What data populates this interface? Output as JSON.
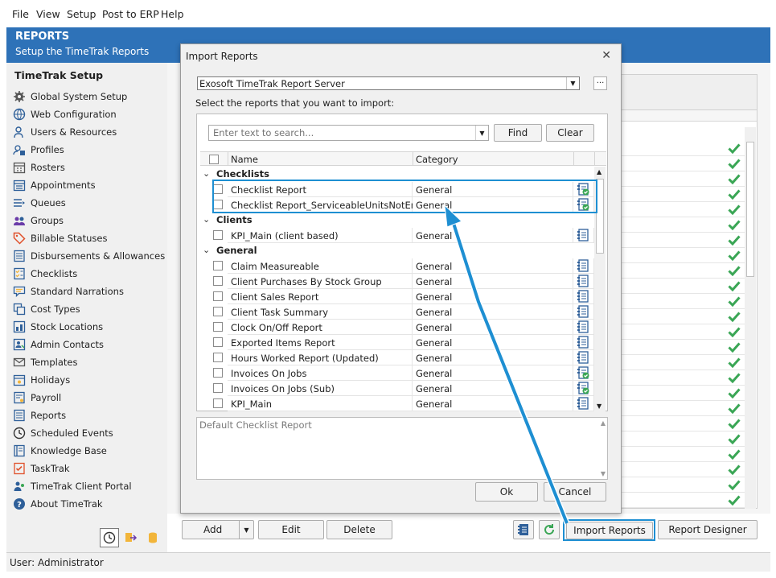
{
  "menu": [
    "File",
    "View",
    "Setup",
    "Post to ERP",
    "Help"
  ],
  "header": {
    "title": "REPORTS",
    "subtitle": "Setup the TimeTrak Reports"
  },
  "nav": {
    "title": "TimeTrak Setup",
    "items": [
      {
        "label": "Global System Setup",
        "icon": "gear-icon"
      },
      {
        "label": "Web Configuration",
        "icon": "globe-icon"
      },
      {
        "label": "Users & Resources",
        "icon": "users-icon"
      },
      {
        "label": "Profiles",
        "icon": "profile-icon"
      },
      {
        "label": "Rosters",
        "icon": "calendar-icon"
      },
      {
        "label": "Appointments",
        "icon": "appointment-icon"
      },
      {
        "label": "Queues",
        "icon": "queue-icon"
      },
      {
        "label": "Groups",
        "icon": "groups-icon"
      },
      {
        "label": "Billable Statuses",
        "icon": "tag-icon"
      },
      {
        "label": "Disbursements & Allowances",
        "icon": "ledger-icon"
      },
      {
        "label": "Checklists",
        "icon": "checklist-icon"
      },
      {
        "label": "Standard Narrations",
        "icon": "narration-icon"
      },
      {
        "label": "Cost Types",
        "icon": "cost-icon"
      },
      {
        "label": "Stock Locations",
        "icon": "stock-icon"
      },
      {
        "label": "Admin Contacts",
        "icon": "contacts-icon"
      },
      {
        "label": "Templates",
        "icon": "mail-icon"
      },
      {
        "label": "Holidays",
        "icon": "holiday-icon"
      },
      {
        "label": "Payroll",
        "icon": "payroll-icon"
      },
      {
        "label": "Reports",
        "icon": "report-icon"
      },
      {
        "label": "Scheduled Events",
        "icon": "clock-icon"
      },
      {
        "label": "Knowledge Base",
        "icon": "book-icon"
      },
      {
        "label": "TaskTrak",
        "icon": "tasktrak-icon"
      },
      {
        "label": "TimeTrak Client Portal",
        "icon": "portal-icon"
      },
      {
        "label": "About TimeTrak",
        "icon": "help-icon"
      }
    ]
  },
  "bottom_buttons": {
    "add": "Add",
    "edit": "Edit",
    "delete": "Delete",
    "import_reports": "Import Reports",
    "report_designer": "Report Designer"
  },
  "status": {
    "user": "User: Administrator"
  },
  "dialog": {
    "title": "Import Reports",
    "server": "Exosoft TimeTrak Report Server",
    "prompt": "Select the reports that you want to import:",
    "search_placeholder": "Enter text to search...",
    "find": "Find",
    "clear": "Clear",
    "columns": {
      "name": "Name",
      "category": "Category"
    },
    "groups": [
      {
        "label": "Checklists",
        "rows": [
          {
            "name": "Checklist Report",
            "category": "General",
            "status": "installed"
          },
          {
            "name": "Checklist Report_ServiceableUnitsNotEnabled",
            "category": "General",
            "status": "installed"
          }
        ]
      },
      {
        "label": "Clients",
        "rows": [
          {
            "name": "KPI_Main (client based)",
            "category": "General",
            "status": "available"
          }
        ]
      },
      {
        "label": "General",
        "rows": [
          {
            "name": "Claim Measureable",
            "category": "General",
            "status": "available"
          },
          {
            "name": "Client Purchases By Stock Group",
            "category": "General",
            "status": "available"
          },
          {
            "name": "Client Sales Report",
            "category": "General",
            "status": "available"
          },
          {
            "name": "Client Task Summary",
            "category": "General",
            "status": "available"
          },
          {
            "name": "Clock On/Off Report",
            "category": "General",
            "status": "available"
          },
          {
            "name": "Exported Items Report",
            "category": "General",
            "status": "available"
          },
          {
            "name": "Hours Worked Report (Updated)",
            "category": "General",
            "status": "available"
          },
          {
            "name": "Invoices On Jobs",
            "category": "General",
            "status": "installed"
          },
          {
            "name": "Invoices On Jobs (Sub)",
            "category": "General",
            "status": "installed"
          },
          {
            "name": "KPI_Main",
            "category": "General",
            "status": "available"
          }
        ]
      }
    ],
    "description": "Default Checklist Report",
    "ok": "Ok",
    "cancel": "Cancel"
  },
  "colors": {
    "accent": "#2e72b8",
    "highlight": "#1e8fd2",
    "check": "#3aa655"
  }
}
